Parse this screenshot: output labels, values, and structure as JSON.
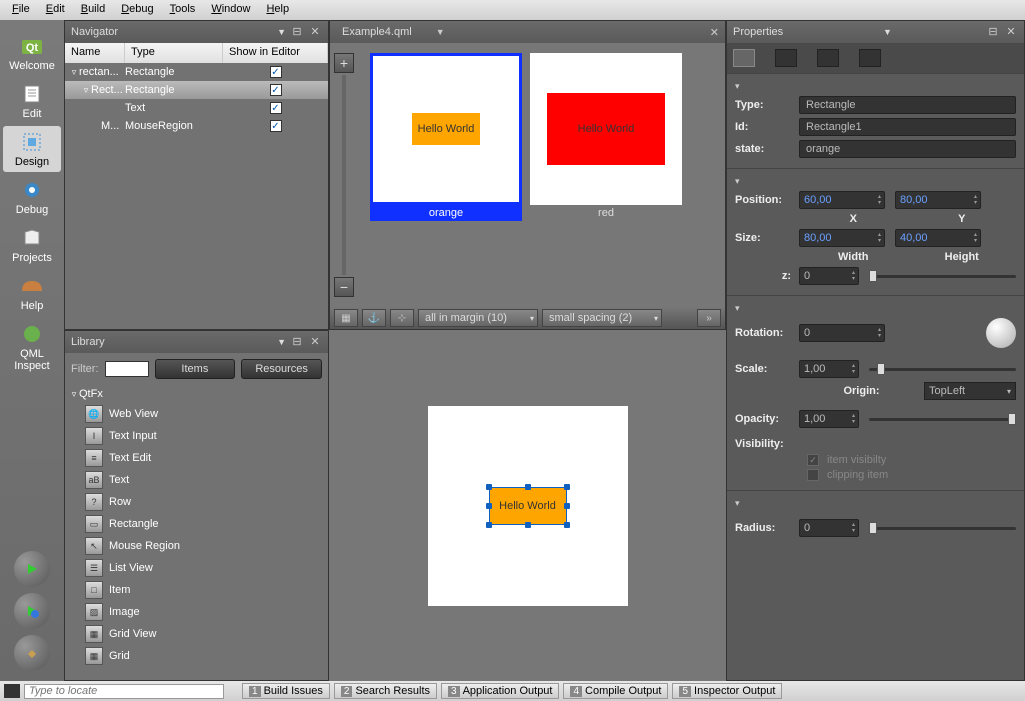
{
  "menubar": [
    "File",
    "Edit",
    "Build",
    "Debug",
    "Tools",
    "Window",
    "Help"
  ],
  "leftbar": {
    "modes": [
      {
        "label": "Welcome",
        "active": false
      },
      {
        "label": "Edit",
        "active": false
      },
      {
        "label": "Design",
        "active": true
      },
      {
        "label": "Debug",
        "active": false
      },
      {
        "label": "Projects",
        "active": false
      },
      {
        "label": "Help",
        "active": false
      },
      {
        "label": "QML Inspect",
        "active": false
      }
    ]
  },
  "navigator": {
    "title": "Navigator",
    "columns": [
      "Name",
      "Type",
      "Show in Editor"
    ],
    "rows": [
      {
        "indent": 0,
        "name": "rectan...",
        "type": "Rectangle",
        "checked": true,
        "expanded": true
      },
      {
        "indent": 1,
        "name": "Rect...",
        "type": "Rectangle",
        "checked": true,
        "expanded": true,
        "selected": true
      },
      {
        "indent": 2,
        "name": "",
        "type": "Text",
        "checked": true
      },
      {
        "indent": 2,
        "name": "M...",
        "type": "MouseRegion",
        "checked": true
      }
    ]
  },
  "states": {
    "tab": "Example4.qml",
    "items": [
      {
        "label": "orange",
        "selected": true,
        "rect": "orange",
        "text": "Hello World"
      },
      {
        "label": "red",
        "selected": false,
        "rect": "red",
        "text": "Hello World"
      }
    ],
    "toolbar": {
      "combo1": "all in margin (10)",
      "combo2": "small spacing (2)"
    }
  },
  "library": {
    "title": "Library",
    "filterLabel": "Filter:",
    "btn1": "Items",
    "btn2": "Resources",
    "category": "QtFx",
    "items": [
      "Web View",
      "Text Input",
      "Text Edit",
      "Text",
      "Row",
      "Rectangle",
      "Mouse Region",
      "List View",
      "Item",
      "Image",
      "Grid View",
      "Grid"
    ]
  },
  "canvas": {
    "text": "Hello World"
  },
  "props": {
    "title": "Properties",
    "type": {
      "label": "Type:",
      "value": "Rectangle"
    },
    "id": {
      "label": "Id:",
      "value": "Rectangle1"
    },
    "state": {
      "label": "state:",
      "value": "orange"
    },
    "position": {
      "label": "Position:",
      "x": "60,00",
      "y": "80,00",
      "xl": "X",
      "yl": "Y"
    },
    "size": {
      "label": "Size:",
      "w": "80,00",
      "h": "40,00",
      "wl": "Width",
      "hl": "Height"
    },
    "z": {
      "label": "z:",
      "v": "0"
    },
    "rotation": {
      "label": "Rotation:",
      "v": "0"
    },
    "scale": {
      "label": "Scale:",
      "v": "1,00"
    },
    "origin": {
      "label": "Origin:",
      "v": "TopLeft"
    },
    "opacity": {
      "label": "Opacity:",
      "v": "1,00"
    },
    "visibility": {
      "label": "Visibility:",
      "c1": "item visibilty",
      "c2": "clipping item"
    },
    "radius": {
      "label": "Radius:",
      "v": "0"
    }
  },
  "statusbar": {
    "placeholder": "Type to locate",
    "buttons": [
      {
        "n": "1",
        "t": "Build Issues"
      },
      {
        "n": "2",
        "t": "Search Results"
      },
      {
        "n": "3",
        "t": "Application Output"
      },
      {
        "n": "4",
        "t": "Compile Output"
      },
      {
        "n": "5",
        "t": "Inspector Output"
      }
    ]
  }
}
